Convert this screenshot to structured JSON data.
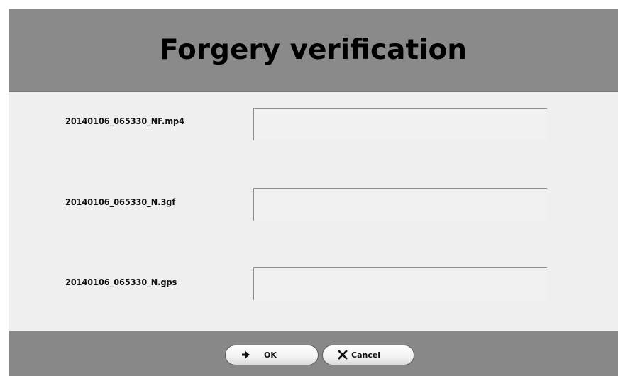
{
  "dialog": {
    "title": "Forgery verification"
  },
  "files": [
    {
      "name": "20140106_065330_NF.mp4",
      "result": ""
    },
    {
      "name": "20140106_065330_N.3gf",
      "result": ""
    },
    {
      "name": "20140106_065330_N.gps",
      "result": ""
    }
  ],
  "buttons": {
    "ok": {
      "label": "OK",
      "icon": "arrow-right-icon"
    },
    "cancel": {
      "label": "Cancel",
      "icon": "close-icon"
    }
  },
  "colors": {
    "header": "#8a8a8a",
    "footer": "#888888",
    "content": "#efefef"
  }
}
